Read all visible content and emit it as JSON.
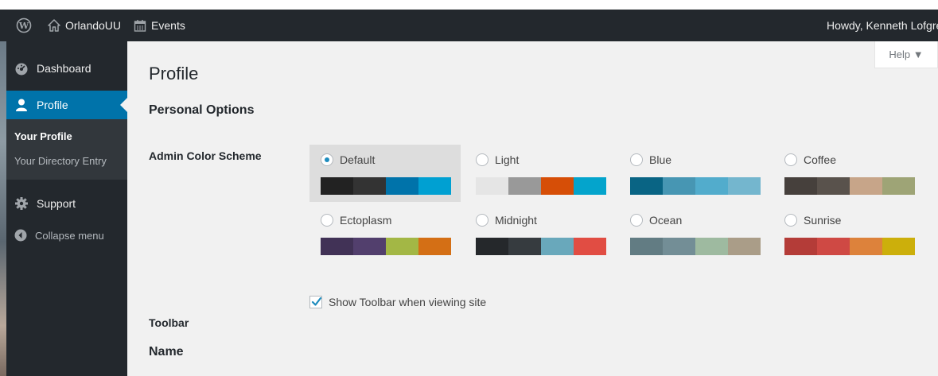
{
  "adminbar": {
    "site_name": "OrlandoUU",
    "events_label": "Events",
    "greeting": "Howdy, Kenneth Lofgren"
  },
  "sidebar": {
    "dashboard": "Dashboard",
    "profile": "Profile",
    "submenu": [
      "Your Profile",
      "Your Directory Entry"
    ],
    "support": "Support",
    "collapse": "Collapse menu"
  },
  "help_label": "Help ▼",
  "page_title": "Profile",
  "personal_options": "Personal Options",
  "color_scheme_label": "Admin Color Scheme",
  "schemes": [
    {
      "name": "Default",
      "selected": true,
      "colors": [
        "#222222",
        "#333333",
        "#0073aa",
        "#00a0d2"
      ]
    },
    {
      "name": "Light",
      "selected": false,
      "colors": [
        "#e5e5e5",
        "#999999",
        "#d64e07",
        "#04a4cc"
      ]
    },
    {
      "name": "Blue",
      "selected": false,
      "colors": [
        "#096484",
        "#4796b3",
        "#52accc",
        "#74b6ce"
      ]
    },
    {
      "name": "Coffee",
      "selected": false,
      "colors": [
        "#46403c",
        "#59524c",
        "#c7a589",
        "#9ea476"
      ]
    },
    {
      "name": "Ectoplasm",
      "selected": false,
      "colors": [
        "#413256",
        "#523f6d",
        "#a3b745",
        "#d46f15"
      ]
    },
    {
      "name": "Midnight",
      "selected": false,
      "colors": [
        "#25282b",
        "#363b3f",
        "#69a8bb",
        "#e14d43"
      ]
    },
    {
      "name": "Ocean",
      "selected": false,
      "colors": [
        "#627c83",
        "#738e96",
        "#9ebaa0",
        "#aa9d88"
      ]
    },
    {
      "name": "Sunrise",
      "selected": false,
      "colors": [
        "#b43c38",
        "#cf4944",
        "#dd823b",
        "#ccaf0b"
      ]
    }
  ],
  "toolbar_label": "Toolbar",
  "toolbar_option": "Show Toolbar when viewing site",
  "toolbar_checked": true,
  "name_section": "Name",
  "colors": {
    "adminbar_bg": "#23282d",
    "accent": "#0073aa",
    "page_bg": "#f1f1f1"
  }
}
